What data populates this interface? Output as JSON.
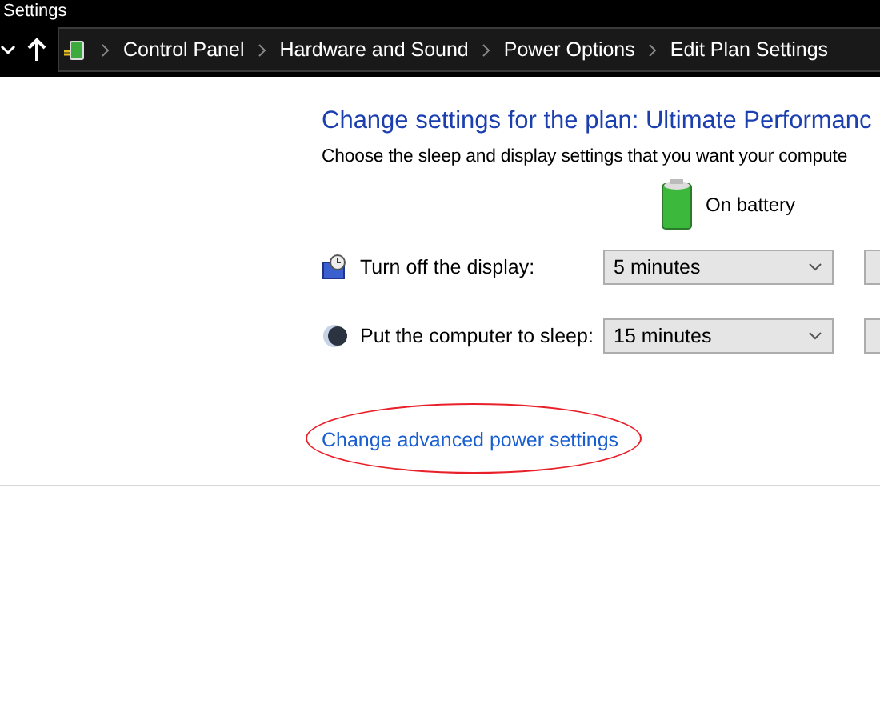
{
  "window": {
    "title": "Settings"
  },
  "address_bar": {
    "crumbs": [
      "Control Panel",
      "Hardware and Sound",
      "Power Options",
      "Edit Plan Settings"
    ]
  },
  "heading": "Change settings for the plan: Ultimate Performanc",
  "subtitle": "Choose the sleep and display settings that you want your compute",
  "column_header": "On battery",
  "settings": [
    {
      "kind": "display",
      "label": "Turn off the display:",
      "value": "5 minutes"
    },
    {
      "kind": "sleep",
      "label": "Put the computer to sleep:",
      "value": "15 minutes"
    }
  ],
  "advanced_link": {
    "label": "Change advanced power settings",
    "highlighted": true
  }
}
